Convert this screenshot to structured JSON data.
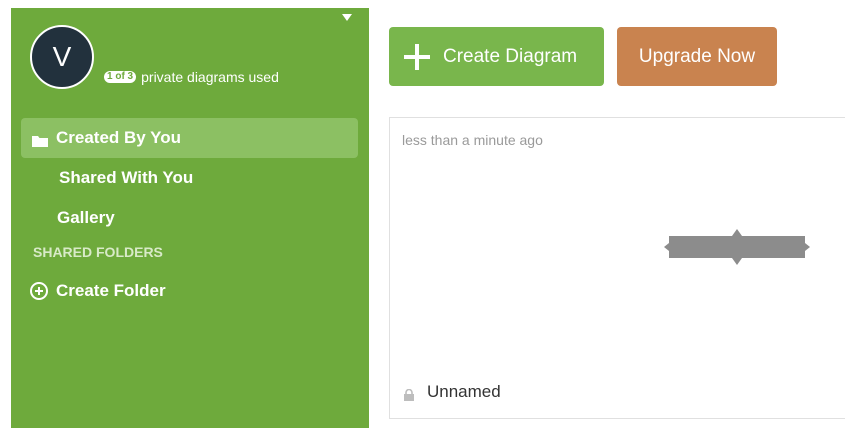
{
  "user": {
    "avatar_initial": "V",
    "usage_badge": "1 of 3",
    "usage_text": "private diagrams used"
  },
  "sidebar": {
    "items": [
      {
        "label": "Created By You",
        "icon": "folder-icon",
        "selected": true
      },
      {
        "label": "Shared With You"
      },
      {
        "label": "Gallery"
      }
    ],
    "section_title": "SHARED FOLDERS",
    "create_folder_label": "Create Folder",
    "create_folder_icon": "plus-circle-icon"
  },
  "toolbar": {
    "create_label": "Create Diagram",
    "create_icon": "plus-icon",
    "upgrade_label": "Upgrade Now"
  },
  "diagrams": [
    {
      "time": "less than a minute ago",
      "name": "Unnamed",
      "lock_icon": "lock-icon"
    }
  ],
  "colors": {
    "sidebar": "#6eaa3c",
    "sidebar_selected": "#8cc063",
    "create_button": "#79b64c",
    "upgrade_button": "#c9834f",
    "avatar": "#22313d"
  }
}
